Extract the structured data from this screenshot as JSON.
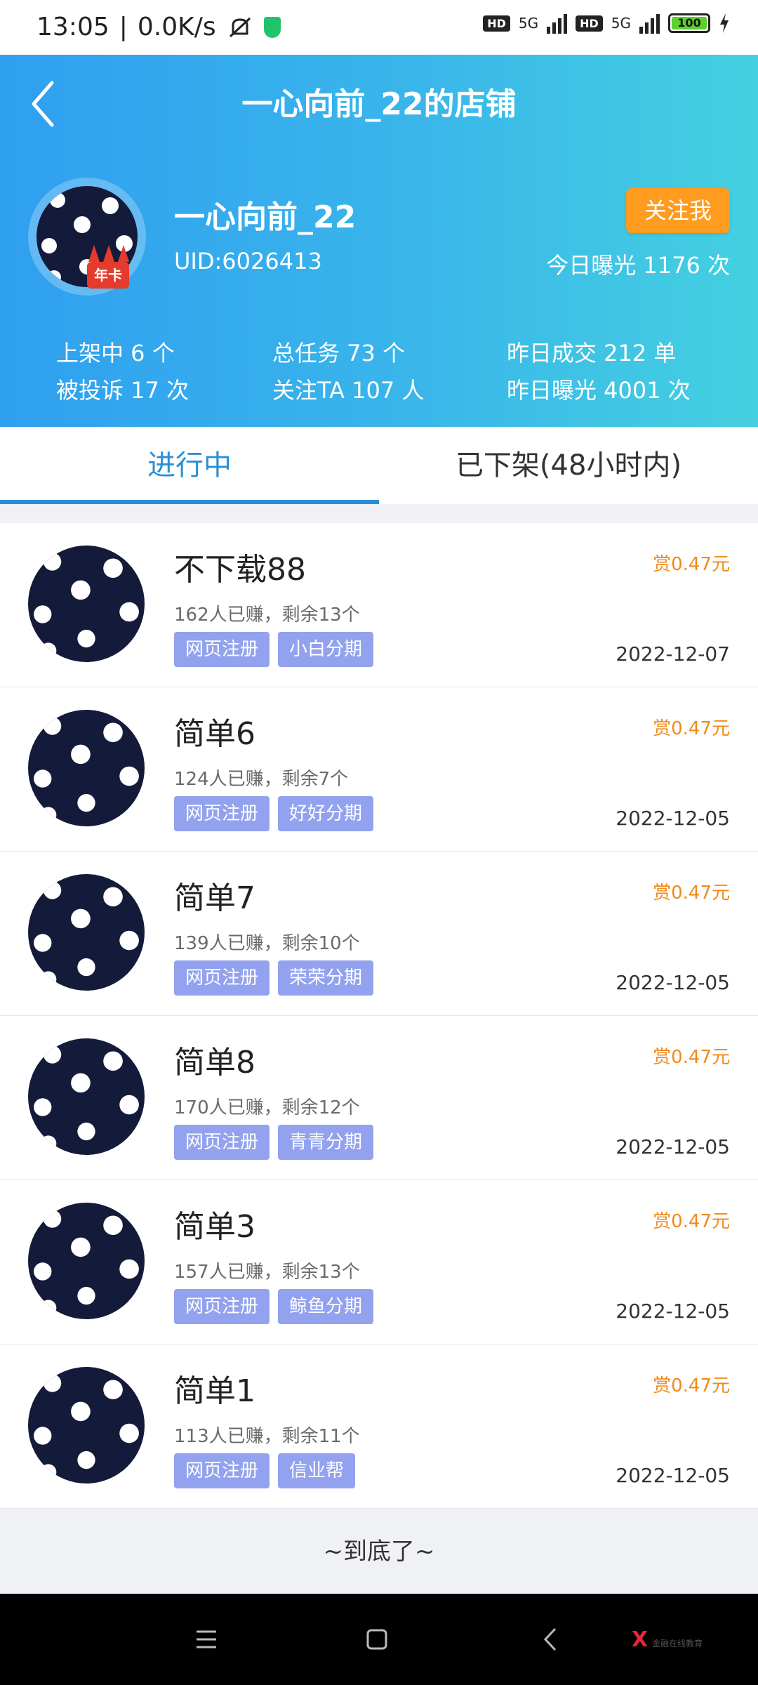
{
  "status_bar": {
    "time": "13:05",
    "speed": "0.0K/s",
    "battery": "100",
    "hd_badge": "HD",
    "network": "5G"
  },
  "header": {
    "title": "一心向前_22的店铺",
    "avatar_badge": "年卡",
    "username": "一心向前_22",
    "uid": "UID:6026413",
    "follow_label": "关注我",
    "today_exposure": "今日曝光 1176 次",
    "stats": {
      "listed": "上架中 6 个",
      "complaints": "被投诉 17 次",
      "total_tasks": "总任务 73 个",
      "followers": "关注TA 107 人",
      "yesterday_deals": "昨日成交 212 单",
      "yesterday_exposure": "昨日曝光 4001 次"
    }
  },
  "tabs": [
    {
      "label": "进行中"
    },
    {
      "label": "已下架(48小时内)"
    }
  ],
  "tasks": [
    {
      "name": "不下载88",
      "meta": "162人已赚，剩余13个",
      "tags": [
        "网页注册",
        "小白分期"
      ],
      "reward": "赏0.47元",
      "date": "2022-12-07"
    },
    {
      "name": "简单6",
      "meta": "124人已赚，剩余7个",
      "tags": [
        "网页注册",
        "好好分期"
      ],
      "reward": "赏0.47元",
      "date": "2022-12-05"
    },
    {
      "name": "简单7",
      "meta": "139人已赚，剩余10个",
      "tags": [
        "网页注册",
        "荣荣分期"
      ],
      "reward": "赏0.47元",
      "date": "2022-12-05"
    },
    {
      "name": "简单8",
      "meta": "170人已赚，剩余12个",
      "tags": [
        "网页注册",
        "青青分期"
      ],
      "reward": "赏0.47元",
      "date": "2022-12-05"
    },
    {
      "name": "简单3",
      "meta": "157人已赚，剩余13个",
      "tags": [
        "网页注册",
        "鲸鱼分期"
      ],
      "reward": "赏0.47元",
      "date": "2022-12-05"
    },
    {
      "name": "简单1",
      "meta": "113人已赚，剩余11个",
      "tags": [
        "网页注册",
        "信业帮"
      ],
      "reward": "赏0.47元",
      "date": "2022-12-05"
    }
  ],
  "end_text": "~到底了~",
  "nav_bar": {
    "logo_text": "X",
    "logo_sub": "金融在线教育"
  },
  "colors": {
    "header_gradient_start": "#2f9ff0",
    "header_gradient_end": "#44d0e0",
    "accent_blue": "#2a8fd6",
    "follow_orange": "#ff9b1e",
    "reward_orange": "#f08a1a",
    "tag_purple": "#93a2ee"
  }
}
